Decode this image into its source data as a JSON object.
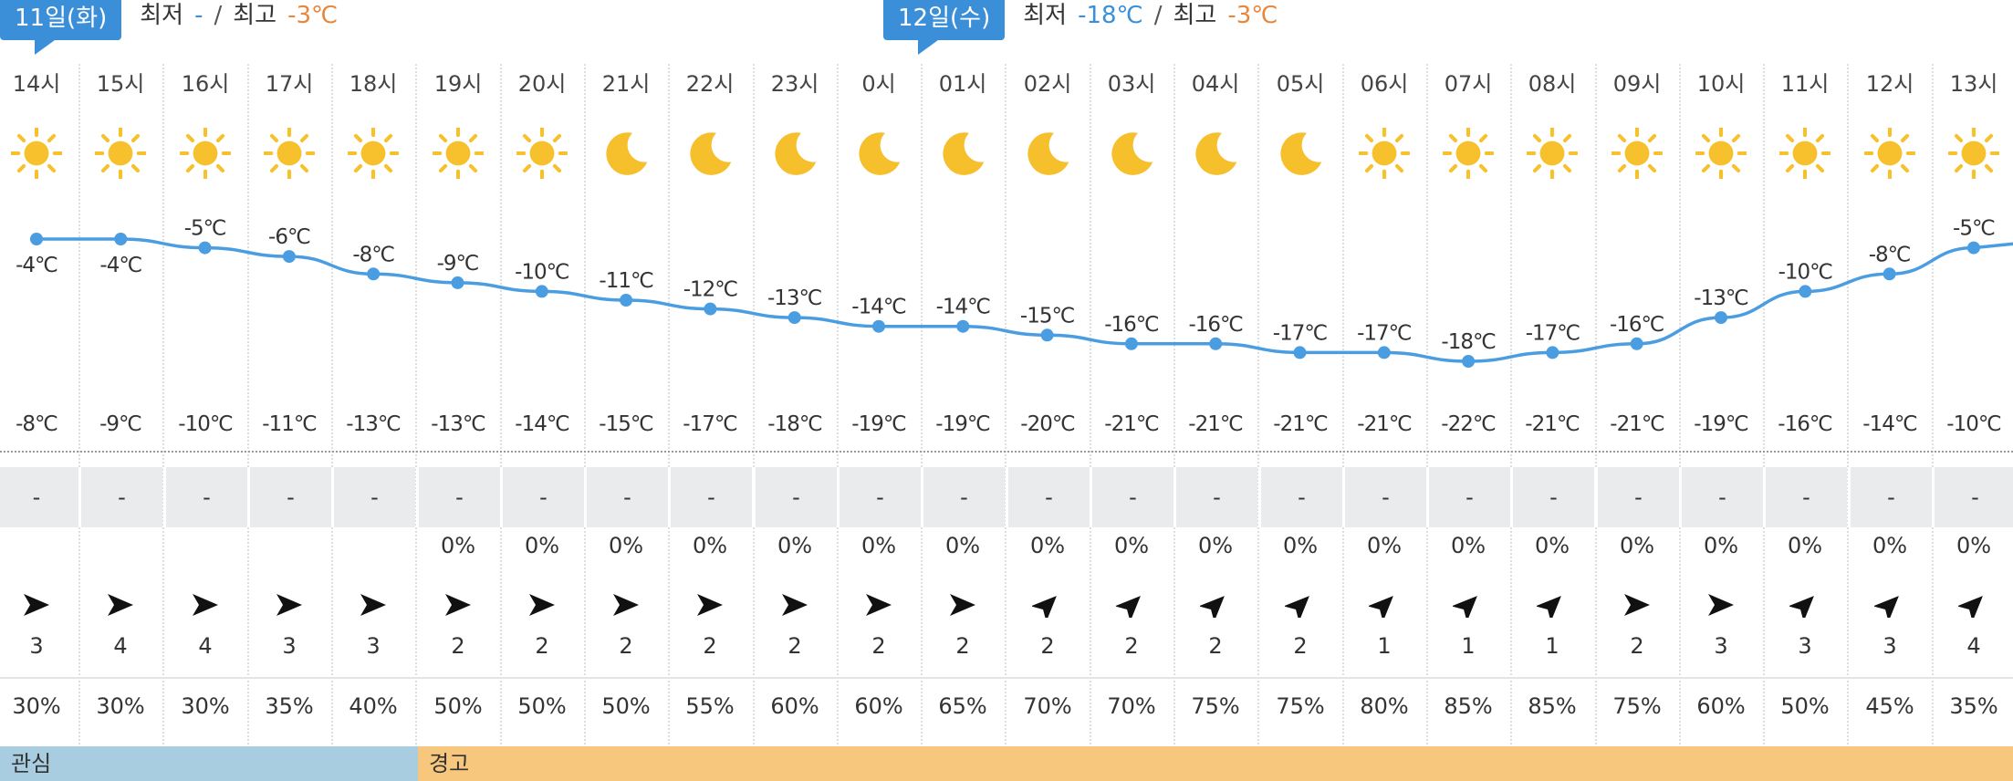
{
  "day_headers": [
    {
      "label": "11일(화)",
      "min_label": "최저",
      "min_value": "-",
      "sep": "/",
      "max_label": "최고",
      "max_value": "-3℃"
    },
    {
      "label": "12일(수)",
      "min_label": "최저",
      "min_value": "-18℃",
      "sep": "/",
      "max_label": "최고",
      "max_value": "-3℃"
    }
  ],
  "hours": [
    {
      "time": "14시",
      "icon": "sun-icon",
      "tmax": "-4℃",
      "tmin": "-8℃",
      "precip": "-",
      "prob": "",
      "wind_dir": "wind-east-arrow-icon",
      "wind_speed": "3",
      "humidity": "30%"
    },
    {
      "time": "15시",
      "icon": "sun-icon",
      "tmax": "-4℃",
      "tmin": "-9℃",
      "precip": "-",
      "prob": "",
      "wind_dir": "wind-east-arrow-icon",
      "wind_speed": "4",
      "humidity": "30%"
    },
    {
      "time": "16시",
      "icon": "sun-icon",
      "tmax": "-5℃",
      "tmin": "-10℃",
      "precip": "-",
      "prob": "",
      "wind_dir": "wind-east-arrow-icon",
      "wind_speed": "4",
      "humidity": "30%"
    },
    {
      "time": "17시",
      "icon": "sun-icon",
      "tmax": "-6℃",
      "tmin": "-11℃",
      "precip": "-",
      "prob": "",
      "wind_dir": "wind-east-arrow-icon",
      "wind_speed": "3",
      "humidity": "35%"
    },
    {
      "time": "18시",
      "icon": "sun-icon",
      "tmax": "-8℃",
      "tmin": "-13℃",
      "precip": "-",
      "prob": "",
      "wind_dir": "wind-east-arrow-icon",
      "wind_speed": "3",
      "humidity": "40%"
    },
    {
      "time": "19시",
      "icon": "sun-icon",
      "tmax": "-9℃",
      "tmin": "-13℃",
      "precip": "-",
      "prob": "0%",
      "wind_dir": "wind-east-arrow-icon",
      "wind_speed": "2",
      "humidity": "50%"
    },
    {
      "time": "20시",
      "icon": "sun-icon",
      "tmax": "-10℃",
      "tmin": "-14℃",
      "precip": "-",
      "prob": "0%",
      "wind_dir": "wind-east-arrow-icon",
      "wind_speed": "2",
      "humidity": "50%"
    },
    {
      "time": "21시",
      "icon": "moon-icon",
      "tmax": "-11℃",
      "tmin": "-15℃",
      "precip": "-",
      "prob": "0%",
      "wind_dir": "wind-east-arrow-icon",
      "wind_speed": "2",
      "humidity": "50%"
    },
    {
      "time": "22시",
      "icon": "moon-icon",
      "tmax": "-12℃",
      "tmin": "-17℃",
      "precip": "-",
      "prob": "0%",
      "wind_dir": "wind-east-arrow-icon",
      "wind_speed": "2",
      "humidity": "55%"
    },
    {
      "time": "23시",
      "icon": "moon-icon",
      "tmax": "-13℃",
      "tmin": "-18℃",
      "precip": "-",
      "prob": "0%",
      "wind_dir": "wind-east-arrow-icon",
      "wind_speed": "2",
      "humidity": "60%"
    },
    {
      "time": "0시",
      "icon": "moon-icon",
      "tmax": "-14℃",
      "tmin": "-19℃",
      "precip": "-",
      "prob": "0%",
      "wind_dir": "wind-east-arrow-icon",
      "wind_speed": "2",
      "humidity": "60%"
    },
    {
      "time": "01시",
      "icon": "moon-icon",
      "tmax": "-14℃",
      "tmin": "-19℃",
      "precip": "-",
      "prob": "0%",
      "wind_dir": "wind-east-arrow-icon",
      "wind_speed": "2",
      "humidity": "65%"
    },
    {
      "time": "02시",
      "icon": "moon-icon",
      "tmax": "-15℃",
      "tmin": "-20℃",
      "precip": "-",
      "prob": "0%",
      "wind_dir": "wind-northeast-arrow-icon",
      "wind_speed": "2",
      "humidity": "70%"
    },
    {
      "time": "03시",
      "icon": "moon-icon",
      "tmax": "-16℃",
      "tmin": "-21℃",
      "precip": "-",
      "prob": "0%",
      "wind_dir": "wind-northeast-arrow-icon",
      "wind_speed": "2",
      "humidity": "70%"
    },
    {
      "time": "04시",
      "icon": "moon-icon",
      "tmax": "-16℃",
      "tmin": "-21℃",
      "precip": "-",
      "prob": "0%",
      "wind_dir": "wind-northeast-arrow-icon",
      "wind_speed": "2",
      "humidity": "75%"
    },
    {
      "time": "05시",
      "icon": "moon-icon",
      "tmax": "-17℃",
      "tmin": "-21℃",
      "precip": "-",
      "prob": "0%",
      "wind_dir": "wind-northeast-arrow-icon",
      "wind_speed": "2",
      "humidity": "75%"
    },
    {
      "time": "06시",
      "icon": "sun-icon",
      "tmax": "-17℃",
      "tmin": "-21℃",
      "precip": "-",
      "prob": "0%",
      "wind_dir": "wind-northeast-arrow-icon",
      "wind_speed": "1",
      "humidity": "80%"
    },
    {
      "time": "07시",
      "icon": "sun-icon",
      "tmax": "-18℃",
      "tmin": "-22℃",
      "precip": "-",
      "prob": "0%",
      "wind_dir": "wind-northeast-arrow-icon",
      "wind_speed": "1",
      "humidity": "85%"
    },
    {
      "time": "08시",
      "icon": "sun-icon",
      "tmax": "-17℃",
      "tmin": "-21℃",
      "precip": "-",
      "prob": "0%",
      "wind_dir": "wind-northeast-arrow-icon",
      "wind_speed": "1",
      "humidity": "85%"
    },
    {
      "time": "09시",
      "icon": "sun-icon",
      "tmax": "-16℃",
      "tmin": "-21℃",
      "precip": "-",
      "prob": "0%",
      "wind_dir": "wind-east-arrow-icon",
      "wind_speed": "2",
      "humidity": "75%"
    },
    {
      "time": "10시",
      "icon": "sun-icon",
      "tmax": "-13℃",
      "tmin": "-19℃",
      "precip": "-",
      "prob": "0%",
      "wind_dir": "wind-east-arrow-icon",
      "wind_speed": "3",
      "humidity": "60%"
    },
    {
      "time": "11시",
      "icon": "sun-icon",
      "tmax": "-10℃",
      "tmin": "-16℃",
      "precip": "-",
      "prob": "0%",
      "wind_dir": "wind-northeast-arrow-icon",
      "wind_speed": "3",
      "humidity": "50%"
    },
    {
      "time": "12시",
      "icon": "sun-icon",
      "tmax": "-8℃",
      "tmin": "-14℃",
      "precip": "-",
      "prob": "0%",
      "wind_dir": "wind-northeast-arrow-icon",
      "wind_speed": "3",
      "humidity": "45%"
    },
    {
      "time": "13시",
      "icon": "sun-icon",
      "tmax": "-5℃",
      "tmin": "-10℃",
      "precip": "-",
      "prob": "0%",
      "wind_dir": "wind-northeast-arrow-icon",
      "wind_speed": "4",
      "humidity": "35%"
    }
  ],
  "chart_data": {
    "type": "line",
    "x": [
      "14시",
      "15시",
      "16시",
      "17시",
      "18시",
      "19시",
      "20시",
      "21시",
      "22시",
      "23시",
      "0시",
      "01시",
      "02시",
      "03시",
      "04시",
      "05시",
      "06시",
      "07시",
      "08시",
      "09시",
      "10시",
      "11시",
      "12시",
      "13시"
    ],
    "series": [
      {
        "values": [
          -4,
          -4,
          -5,
          -6,
          -8,
          -9,
          -10,
          -11,
          -12,
          -13,
          -14,
          -14,
          -15,
          -16,
          -16,
          -17,
          -17,
          -18,
          -17,
          -16,
          -13,
          -10,
          -8,
          -5
        ]
      }
    ]
  },
  "alerts": [
    {
      "label": "관심",
      "color": "#a9cde0"
    },
    {
      "label": "경고",
      "color": "#f6c77d"
    }
  ],
  "colors": {
    "accent": "#3b8fd8",
    "max_temp": "#e8873c",
    "sun": "#f7c12d",
    "moon": "#f5c02c",
    "line": "#4a9de0"
  }
}
